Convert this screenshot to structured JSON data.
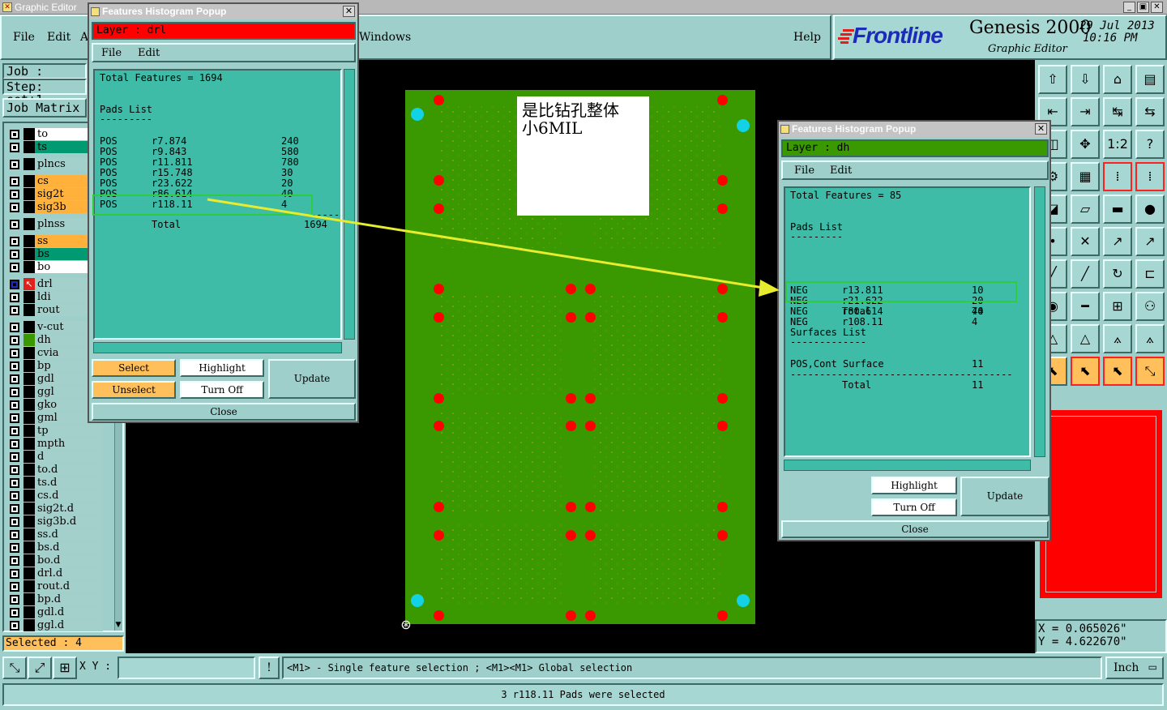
{
  "app": {
    "title": "Graphic Editor",
    "menu": [
      "File",
      "Edit",
      "A",
      "Windows",
      "Help"
    ],
    "brand": "Frontline",
    "product": "Genesis 2000",
    "subtitle": "Graphic Editor",
    "date": "29 Jul 2013",
    "time": "10:16 PM"
  },
  "job": {
    "job_label": "Job : 4s294",
    "step_label": "Step: set+1",
    "matrix_button": "Job Matrix"
  },
  "layers": [
    {
      "name": "to",
      "color": "#ffffff"
    },
    {
      "name": "ts",
      "color": "#009a72"
    },
    {
      "name": "plncs",
      "color": "#a4d0cc"
    },
    {
      "name": "cs",
      "color": "#ffb13b"
    },
    {
      "name": "sig2t",
      "color": "#ffb13b"
    },
    {
      "name": "sig3b",
      "color": "#ffb13b"
    },
    {
      "name": "plnss",
      "color": "#a4d0cc"
    },
    {
      "name": "ss",
      "color": "#ffb13b"
    },
    {
      "name": "bs",
      "color": "#009a72"
    },
    {
      "name": "bo",
      "color": "#ffffff"
    },
    {
      "name": "drl",
      "color": "#a4d0cc"
    },
    {
      "name": "ldi",
      "color": "#a4d0cc"
    },
    {
      "name": "rout",
      "color": "#a4d0cc"
    },
    {
      "name": "v-cut",
      "color": "#a4d0cc"
    },
    {
      "name": "dh",
      "color": "#a4d0cc"
    },
    {
      "name": "cvia",
      "color": "#a4d0cc"
    },
    {
      "name": "bp",
      "color": "#a4d0cc"
    },
    {
      "name": "gdl",
      "color": "#a4d0cc"
    },
    {
      "name": "ggl",
      "color": "#a4d0cc"
    },
    {
      "name": "gko",
      "color": "#a4d0cc"
    },
    {
      "name": "gml",
      "color": "#a4d0cc"
    },
    {
      "name": "tp",
      "color": "#a4d0cc"
    },
    {
      "name": "mpth",
      "color": "#a4d0cc"
    },
    {
      "name": "d",
      "color": "#a4d0cc"
    },
    {
      "name": "to.d",
      "color": "#a4d0cc"
    },
    {
      "name": "ts.d",
      "color": "#a4d0cc"
    },
    {
      "name": "cs.d",
      "color": "#a4d0cc"
    },
    {
      "name": "sig2t.d",
      "color": "#a4d0cc"
    },
    {
      "name": "sig3b.d",
      "color": "#a4d0cc"
    },
    {
      "name": "ss.d",
      "color": "#a4d0cc"
    },
    {
      "name": "bs.d",
      "color": "#a4d0cc"
    },
    {
      "name": "bo.d",
      "color": "#a4d0cc"
    },
    {
      "name": "drl.d",
      "color": "#a4d0cc"
    },
    {
      "name": "rout.d",
      "color": "#a4d0cc"
    },
    {
      "name": "bp.d",
      "color": "#a4d0cc"
    },
    {
      "name": "gdl.d",
      "color": "#a4d0cc"
    },
    {
      "name": "ggl.d",
      "color": "#a4d0cc"
    }
  ],
  "selected": "Selected : 4",
  "annotation": {
    "line1": "是比钻孔整体",
    "line2": "小6MIL"
  },
  "popup1": {
    "title": "Features Histogram Popup",
    "layer": "Layer :  drl",
    "menu_file": "File",
    "menu_edit": "Edit",
    "total_features": "Total Features = 1694",
    "section": "Pads List",
    "rows": [
      {
        "pol": "POS",
        "sym": "r7.874",
        "count": "240"
      },
      {
        "pol": "POS",
        "sym": "r9.843",
        "count": "580"
      },
      {
        "pol": "POS",
        "sym": "r11.811",
        "count": "780"
      },
      {
        "pol": "POS",
        "sym": "r15.748",
        "count": "30"
      },
      {
        "pol": "POS",
        "sym": "r23.622",
        "count": "20"
      },
      {
        "pol": "POS",
        "sym": "r86.614",
        "count": "40"
      },
      {
        "pol": "POS",
        "sym": "r118.11",
        "count": "4"
      }
    ],
    "total_label": "Total",
    "total_value": "1694",
    "select": "Select",
    "unselect": "Unselect",
    "highlight": "Highlight",
    "turn_off": "Turn Off",
    "update": "Update",
    "close": "Close"
  },
  "popup2": {
    "title": "Features Histogram Popup",
    "layer": "Layer :  dh",
    "menu_file": "File",
    "menu_edit": "Edit",
    "total_features": "Total Features = 85",
    "section": "Pads List",
    "rows": [
      {
        "pol": "NEG",
        "sym": "r13.811",
        "count": "10"
      },
      {
        "pol": "NEG",
        "sym": "r21.622",
        "count": "20"
      },
      {
        "pol": "NEG",
        "sym": "r80.614",
        "count": "40"
      },
      {
        "pol": "NEG",
        "sym": "r108.11",
        "count": "4"
      }
    ],
    "total_label": "Total",
    "total_value": "74",
    "section2": "Surfaces List",
    "surface": {
      "pol": "POS,Cont Surface",
      "count": "11"
    },
    "total2_value": "11",
    "highlight": "Highlight",
    "turn_off": "Turn Off",
    "update": "Update",
    "close": "Close"
  },
  "coords": {
    "x": "X = 0.065026\"",
    "y": "Y = 4.622670\""
  },
  "statusbar": {
    "xy_label": "X Y :",
    "xy_value": "",
    "hint": "<M1> - Single feature selection ; <M1><M1> Global selection",
    "unit": "Inch",
    "message": "3 r118.11 Pads were selected"
  }
}
